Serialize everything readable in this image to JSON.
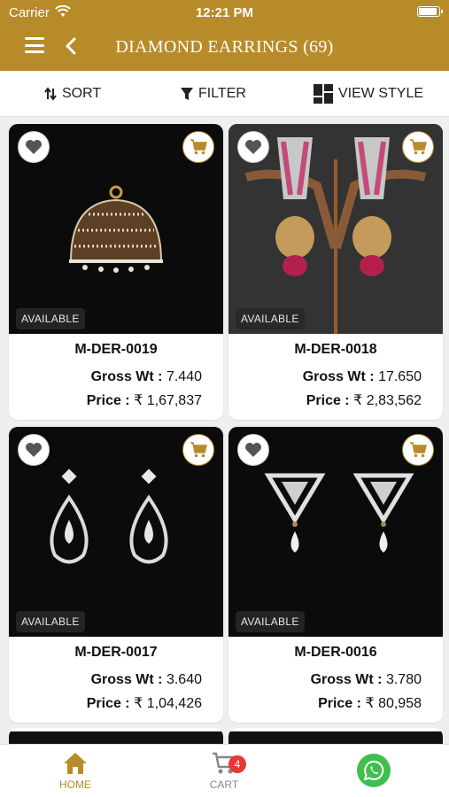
{
  "status_bar": {
    "carrier": "Carrier",
    "time": "12:21 PM",
    "battery_level": 0.95
  },
  "header": {
    "title": "DIAMOND EARRINGS (69)"
  },
  "toolbar": {
    "sort_label": "SORT",
    "filter_label": "FILTER",
    "view_style_label": "VIEW STYLE"
  },
  "products": [
    {
      "code": "M-DER-0019",
      "gross_wt_label": "Gross Wt :",
      "gross_wt": "7.440",
      "price_label": "Price :",
      "price": "₹ 1,67,837",
      "availability": "AVAILABLE"
    },
    {
      "code": "M-DER-0018",
      "gross_wt_label": "Gross Wt :",
      "gross_wt": "17.650",
      "price_label": "Price :",
      "price": "₹ 2,83,562",
      "availability": "AVAILABLE"
    },
    {
      "code": "M-DER-0017",
      "gross_wt_label": "Gross Wt :",
      "gross_wt": "3.640",
      "price_label": "Price :",
      "price": "₹ 1,04,426",
      "availability": "AVAILABLE"
    },
    {
      "code": "M-DER-0016",
      "gross_wt_label": "Gross Wt :",
      "gross_wt": "3.780",
      "price_label": "Price :",
      "price": "₹ 80,958",
      "availability": "AVAILABLE"
    }
  ],
  "bottom_nav": {
    "home_label": "HOME",
    "cart_label": "CART",
    "cart_count": "4"
  },
  "colors": {
    "brand": "#b88b2a",
    "badge": "#e53935",
    "whatsapp": "#3fbf4f"
  }
}
